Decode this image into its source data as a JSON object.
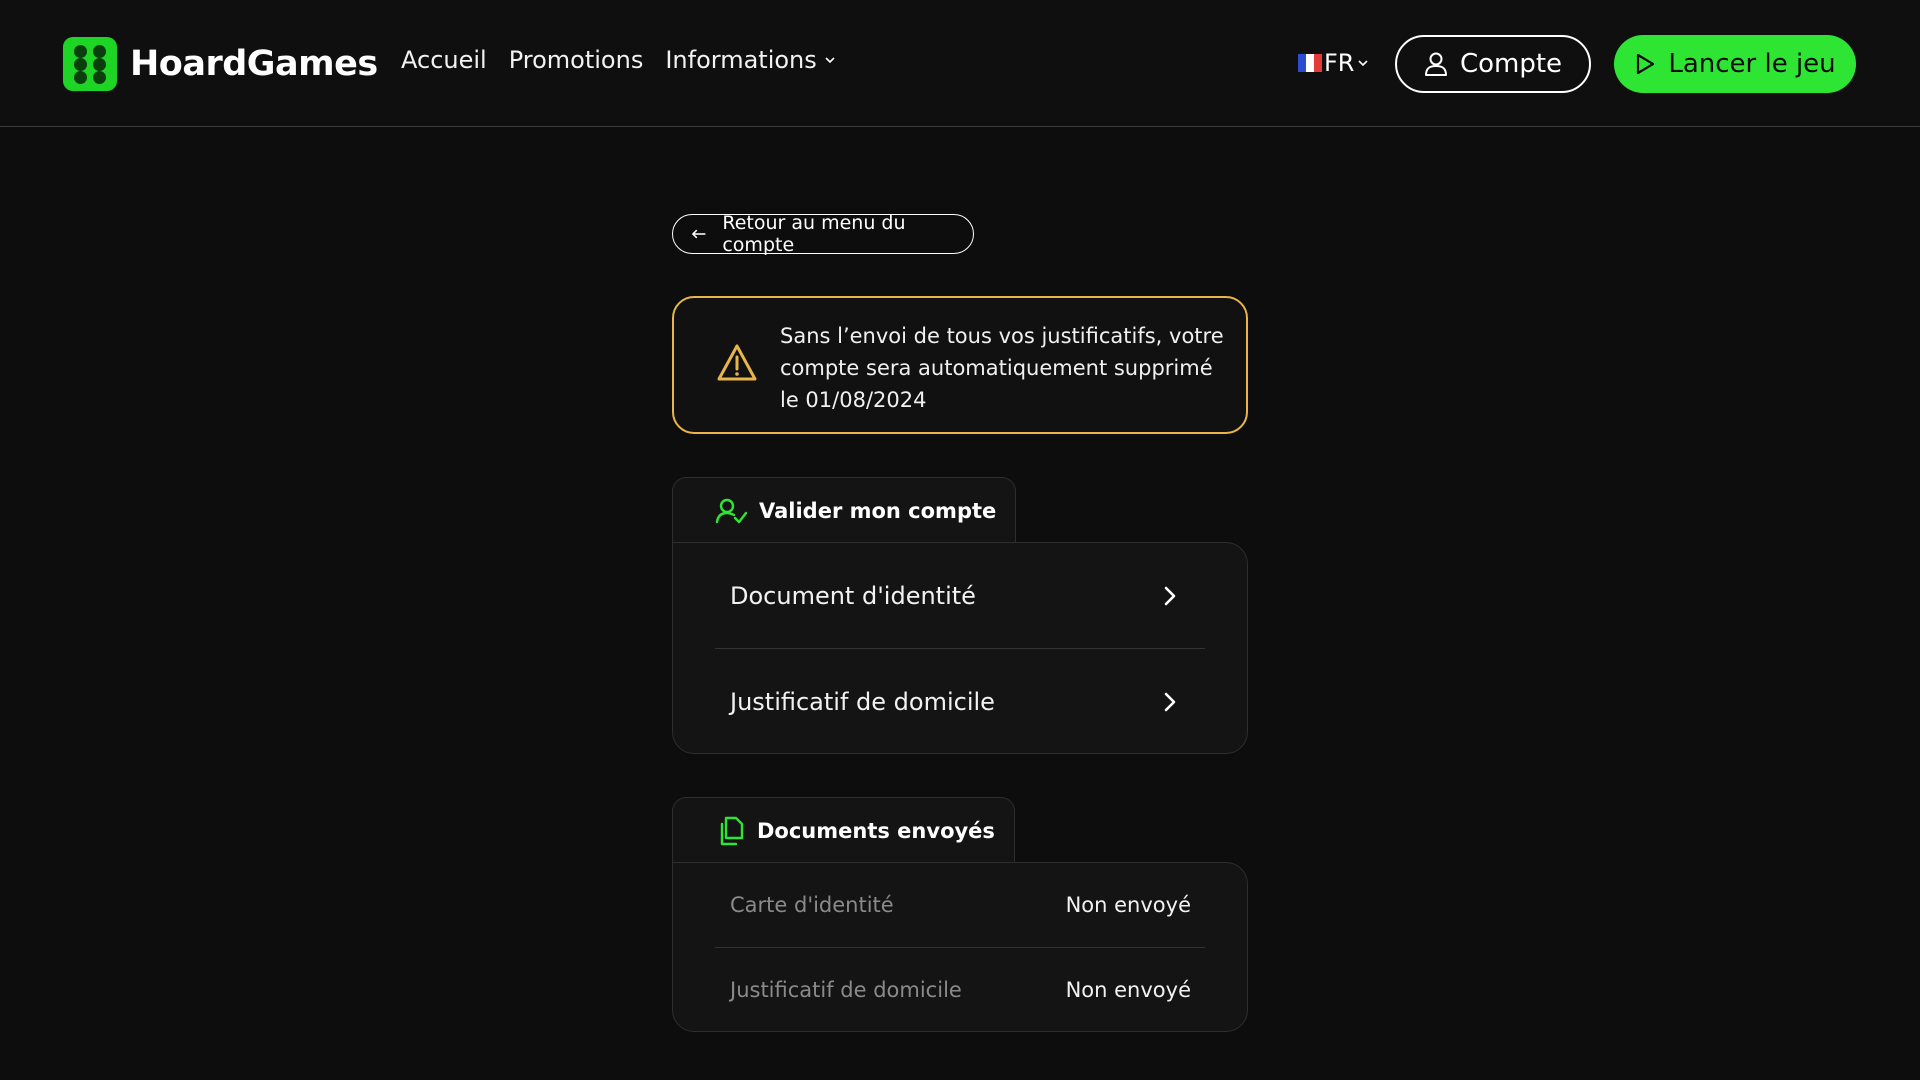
{
  "header": {
    "brand": "HoardGames",
    "nav": [
      {
        "label": "Accueil"
      },
      {
        "label": "Promotions"
      },
      {
        "label": "Informations",
        "has_dropdown": true
      }
    ],
    "language": "FR",
    "account_label": "Compte",
    "play_label": "Lancer le jeu"
  },
  "back_label": "Retour au menu du compte",
  "warning": {
    "text": "Sans l’envoi de tous vos justificatifs, votre compte sera automatiquement supprimé le 01/08/2024"
  },
  "validate": {
    "title": "Valider mon compte",
    "items": [
      {
        "label": "Document d'identité"
      },
      {
        "label": "Justificatif de domicile"
      }
    ]
  },
  "sent": {
    "title": "Documents envoyés",
    "rows": [
      {
        "name": "Carte d'identité",
        "status": "Non envoyé"
      },
      {
        "name": "Justificatif de domicile",
        "status": "Non envoyé"
      }
    ]
  },
  "colors": {
    "accent": "#2ee533",
    "brand": "#1ed425",
    "warning": "#e7b54a",
    "background": "#0d0d0d"
  },
  "icons": {
    "logo": "dice-six-icon",
    "account": "user-icon",
    "play": "play-icon",
    "back": "arrow-left-icon",
    "warning": "warning-triangle-icon",
    "validate": "user-check-icon",
    "sent": "documents-icon",
    "row": "chevron-right-icon"
  }
}
